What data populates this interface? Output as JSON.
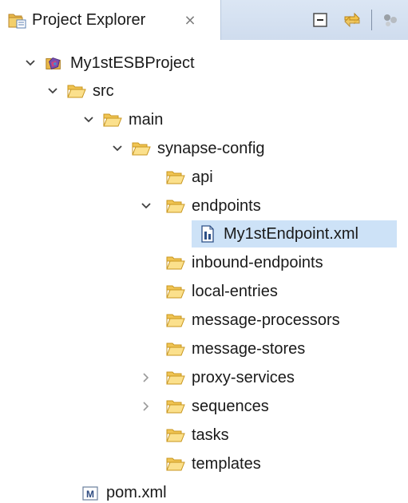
{
  "view": {
    "title": "Project Explorer",
    "close_glyph": "⨯",
    "icon": "project-explorer-icon",
    "toolbar": [
      "collapse-all-icon",
      "link-with-editor-icon",
      "view-menu-icon"
    ]
  },
  "tree": [
    {
      "label": "My1stESBProject",
      "icon": "esb-project-icon",
      "twisty": "expanded"
    },
    {
      "label": "src",
      "icon": "folder-open-icon",
      "twisty": "expanded"
    },
    {
      "label": "main",
      "icon": "folder-open-icon",
      "twisty": "expanded"
    },
    {
      "label": "synapse-config",
      "icon": "folder-open-icon",
      "twisty": "expanded"
    },
    {
      "label": "api",
      "icon": "folder-open-icon",
      "twisty": "none"
    },
    {
      "label": "endpoints",
      "icon": "folder-open-icon",
      "twisty": "expanded"
    },
    {
      "label": "My1stEndpoint.xml",
      "icon": "endpoint-file-icon",
      "twisty": "none",
      "selected": true
    },
    {
      "label": "inbound-endpoints",
      "icon": "folder-open-icon",
      "twisty": "none"
    },
    {
      "label": "local-entries",
      "icon": "folder-open-icon",
      "twisty": "none"
    },
    {
      "label": "message-processors",
      "icon": "folder-open-icon",
      "twisty": "none"
    },
    {
      "label": "message-stores",
      "icon": "folder-open-icon",
      "twisty": "none"
    },
    {
      "label": "proxy-services",
      "icon": "folder-open-icon",
      "twisty": "collapsed"
    },
    {
      "label": "sequences",
      "icon": "folder-open-icon",
      "twisty": "collapsed"
    },
    {
      "label": "tasks",
      "icon": "folder-open-icon",
      "twisty": "none"
    },
    {
      "label": "templates",
      "icon": "folder-open-icon",
      "twisty": "none"
    },
    {
      "label": "pom.xml",
      "icon": "maven-pom-icon",
      "twisty": "none"
    }
  ],
  "colors": {
    "selection": "#cde2f7",
    "folder": "#f2c94c",
    "folder_edge": "#c8961e",
    "tab_strip": "#d4e0f0"
  }
}
